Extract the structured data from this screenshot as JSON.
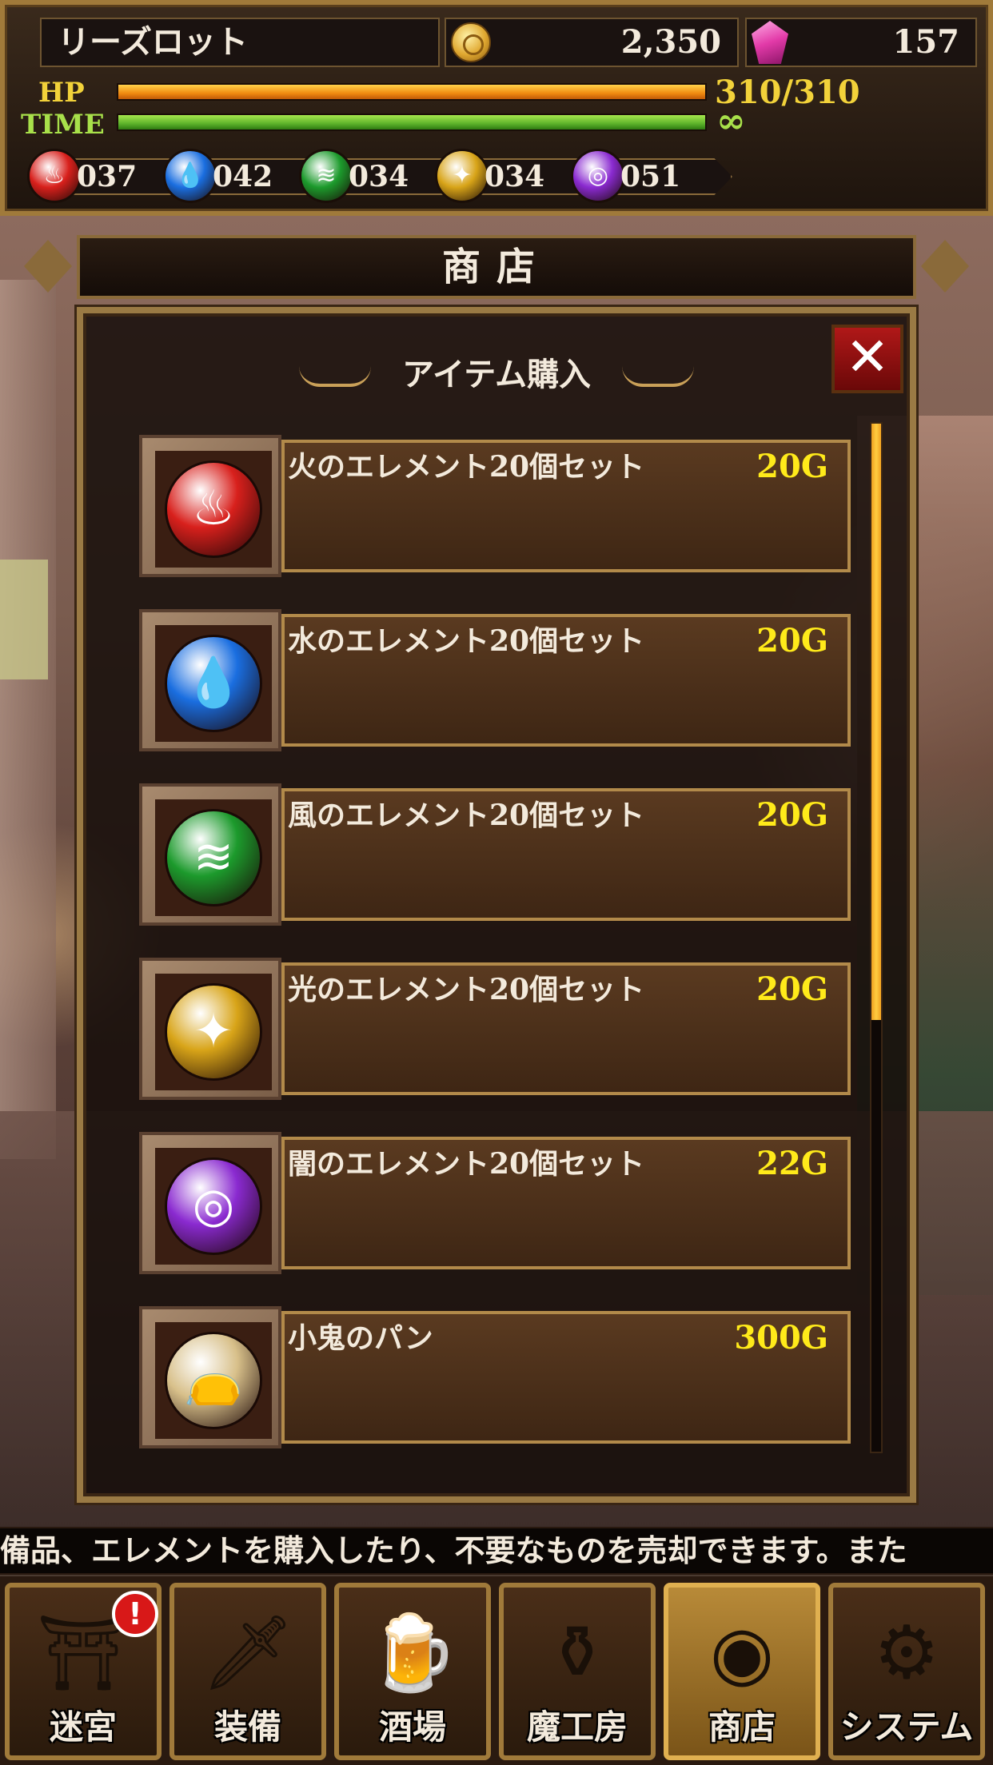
{
  "player": {
    "name": "リーズロット",
    "gold": "2,350",
    "gems": "157",
    "hp_label": "HP",
    "hp_value": "310/310",
    "hp_fraction": 1.0,
    "time_label": "TIME",
    "time_value": "∞",
    "time_fraction": 1.0
  },
  "elements": [
    {
      "icon": "fire-icon",
      "glyph": "♨",
      "count": "037",
      "color": "#d8201c"
    },
    {
      "icon": "water-icon",
      "glyph": "💧",
      "count": "042",
      "color": "#1a6ee0"
    },
    {
      "icon": "wind-icon",
      "glyph": "≋",
      "count": "034",
      "color": "#1c9a2c"
    },
    {
      "icon": "light-icon",
      "glyph": "✦",
      "count": "034",
      "color": "#d8a418"
    },
    {
      "icon": "dark-icon",
      "glyph": "◎",
      "count": "051",
      "color": "#8a2ad0"
    }
  ],
  "header": {
    "title": "商店"
  },
  "dialog": {
    "title": "アイテム購入",
    "close_glyph": "✕",
    "scroll_fraction": 0.58
  },
  "items": [
    {
      "name": "火のエレメント20個セット",
      "price": "20G",
      "icon": "fire-orb-icon",
      "glyph": "♨",
      "color": "#d8201c"
    },
    {
      "name": "水のエレメント20個セット",
      "price": "20G",
      "icon": "water-orb-icon",
      "glyph": "💧",
      "color": "#1a6ee0"
    },
    {
      "name": "風のエレメント20個セット",
      "price": "20G",
      "icon": "wind-orb-icon",
      "glyph": "≋",
      "color": "#1c9a2c"
    },
    {
      "name": "光のエレメント20個セット",
      "price": "20G",
      "icon": "light-orb-icon",
      "glyph": "✦",
      "color": "#d8a418"
    },
    {
      "name": "闇のエレメント20個セット",
      "price": "22G",
      "icon": "dark-orb-icon",
      "glyph": "◎",
      "color": "#8a2ad0"
    },
    {
      "name": "小鬼のパン",
      "price": "300G",
      "icon": "bread-bag-icon",
      "glyph": "👝",
      "color": "#d8c08a"
    }
  ],
  "ticker": "備品、エレメントを購入したり、不要なものを売却できます。また",
  "nav": [
    {
      "label": "迷宮",
      "icon": "dungeon-door-icon",
      "glyph": "⛩",
      "alert": "!",
      "active": false
    },
    {
      "label": "装備",
      "icon": "sword-icon",
      "glyph": "🗡",
      "alert": "",
      "active": false
    },
    {
      "label": "酒場",
      "icon": "beer-mug-icon",
      "glyph": "🍺",
      "alert": "",
      "active": false
    },
    {
      "label": "魔工房",
      "icon": "cauldron-icon",
      "glyph": "⚱",
      "alert": "",
      "active": false
    },
    {
      "label": "商店",
      "icon": "shop-coin-icon",
      "glyph": "◉",
      "alert": "",
      "active": true
    },
    {
      "label": "システム",
      "icon": "gear-icon",
      "glyph": "⚙",
      "alert": "",
      "active": false
    }
  ]
}
